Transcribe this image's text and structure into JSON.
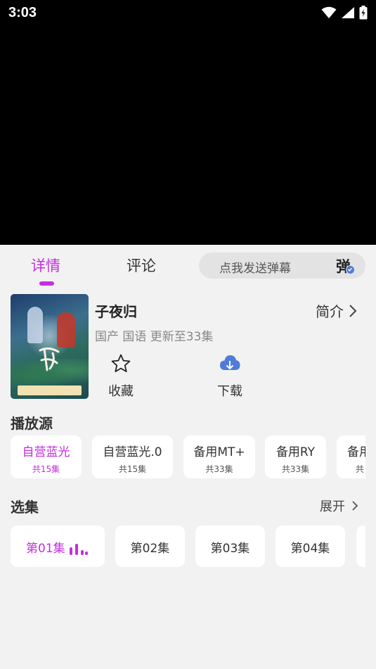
{
  "status_bar": {
    "time": "3:03"
  },
  "tabs": {
    "details": "详情",
    "comments": "评论"
  },
  "danmaku": {
    "placeholder": "点我发送弹幕",
    "toggle_char": "弹"
  },
  "show": {
    "title": "子夜归",
    "intro_label": "简介",
    "meta": "国产 国语 更新至33集"
  },
  "actions": {
    "favorite": "收藏",
    "download": "下载"
  },
  "sources": {
    "title": "播放源",
    "items": [
      {
        "name": "自营蓝光",
        "count": "共15集",
        "active": true
      },
      {
        "name": "自营蓝光.0",
        "count": "共15集",
        "active": false
      },
      {
        "name": "备用MT+",
        "count": "共33集",
        "active": false
      },
      {
        "name": "备用RY",
        "count": "共33集",
        "active": false
      },
      {
        "name": "备用",
        "count": "共",
        "active": false
      }
    ]
  },
  "episodes": {
    "title": "选集",
    "expand_label": "展开",
    "items": [
      {
        "label": "第01集",
        "active": true
      },
      {
        "label": "第02集",
        "active": false
      },
      {
        "label": "第03集",
        "active": false
      },
      {
        "label": "第04集",
        "active": false
      }
    ]
  },
  "colors": {
    "accent": "#c42ee0",
    "download_icon": "#4f7cd8"
  }
}
